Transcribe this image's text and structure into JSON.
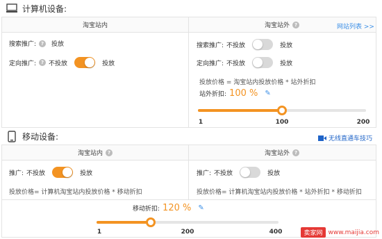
{
  "computer": {
    "title": "计算机设备:",
    "inside_col": "淘宝站内",
    "outside_col": "淘宝站外",
    "site_list_link": "网站列表 >>",
    "search_promo_label": "搜索推广:",
    "search_promo_value": "投放",
    "targeting_label": "定向推广:",
    "off_text": "不投放",
    "on_text": "投放",
    "outside_search_label": "搜索推广:",
    "outside_targeting_label": "定向推广:",
    "price_formula": "投放价格 = 淘宝站内投放价格 * 站外折扣",
    "discount_label": "站外折扣:",
    "discount_value": "100 %",
    "slider": {
      "min_label": "1",
      "mid_label": "100",
      "max_label": "200",
      "min": 1,
      "max": 200,
      "value": 100
    },
    "inside_targeting_on": true,
    "outside_search_on": false,
    "outside_targeting_on": false
  },
  "mobile": {
    "title": "移动设备:",
    "tips_link": "无线直通车技巧",
    "inside_col": "淘宝站内",
    "outside_col": "淘宝站外",
    "promo_label": "推广:",
    "off_text": "不投放",
    "on_text": "投放",
    "inside_formula": "投放价格= 计算机淘宝站内投放价格 * 移动折扣",
    "outside_formula": "投放价格= 计算机淘宝站内投放价格 * 站外折扣 * 移动折扣",
    "discount_label": "移动折扣:",
    "discount_value": "120 %",
    "slider": {
      "min_label": "1",
      "mid_label": "200",
      "max_label": "400",
      "min": 1,
      "max": 400,
      "value": 120
    },
    "inside_on": true,
    "outside_on": false
  },
  "watermark": {
    "badge": "卖家网",
    "url": "www.maijia.com"
  },
  "colors": {
    "accent": "#f39322",
    "link": "#3a8ee6",
    "toggle_off": "#d9d9d9"
  }
}
